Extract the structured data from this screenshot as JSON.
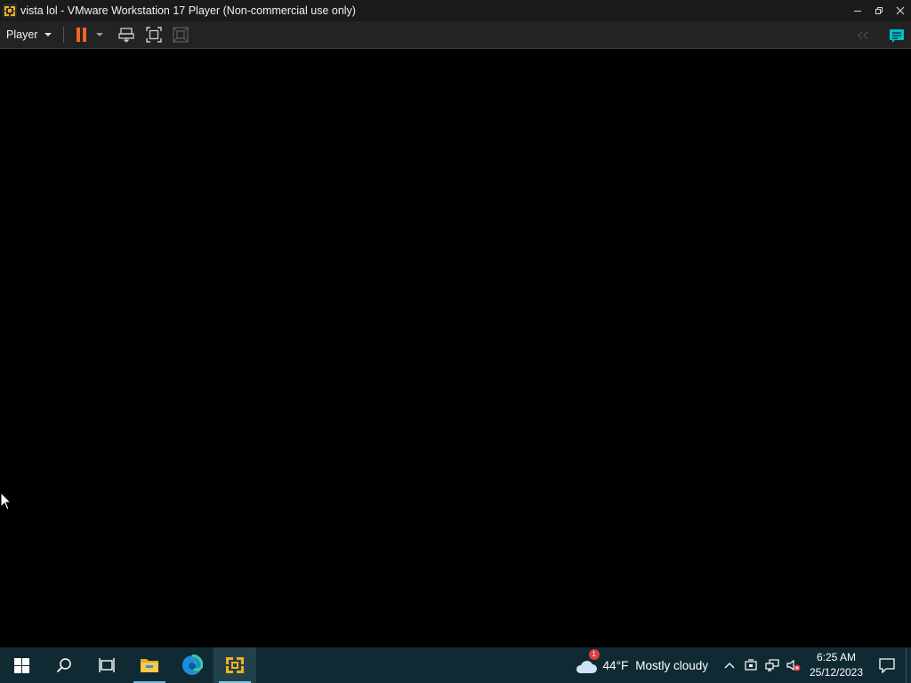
{
  "window": {
    "title": "vista lol - VMware Workstation 17 Player (Non-commercial use only)",
    "icon": "vmware-player-icon",
    "controls": [
      "minimize-icon",
      "restore-icon",
      "close-icon"
    ]
  },
  "toolbar": {
    "player_menu_label": "Player",
    "buttons": [
      "pause-icon",
      "dropdown-icon",
      "send-ctrl-alt-del-icon",
      "full-screen-icon",
      "unity-icon"
    ],
    "right_buttons": [
      "fit-guest-icon",
      "library-icon"
    ]
  },
  "colors": {
    "titlebar": "#1b1b1b",
    "toolbar": "#232323",
    "pause_orange": "#f26522",
    "vm_background": "#000000",
    "taskbar": "#0f2a33",
    "vmware_yellow": "#f0b21d",
    "library_teal": "#00c0c9"
  },
  "taskbar": {
    "apps": [
      "start-icon",
      "search-icon",
      "task-view-icon",
      "file-explorer-icon",
      "edge-icon",
      "vmware-player-icon"
    ],
    "active_app": "vmware-player-icon",
    "weather": {
      "badge": "1",
      "temperature": "44°F",
      "description": "Mostly cloudy"
    },
    "tray_icons": [
      "chevron-up-icon",
      "vmware-tray-icon",
      "network-icon",
      "volume-muted-icon"
    ],
    "clock": {
      "time": "6:25 AM",
      "date": "25/12/2023"
    },
    "notifications_icon": "action-center-icon"
  }
}
